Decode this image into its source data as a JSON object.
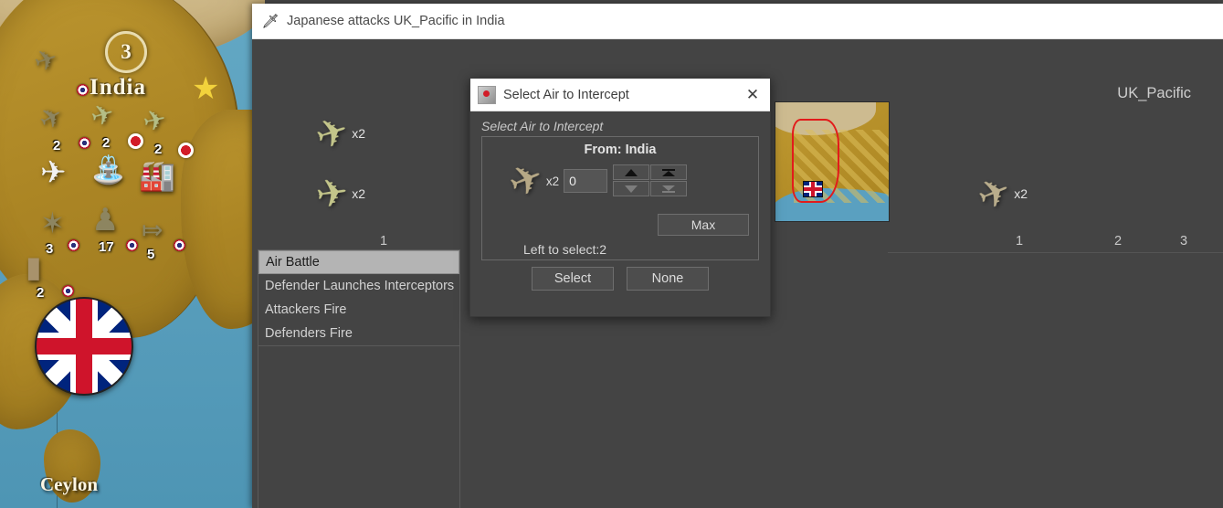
{
  "window": {
    "title": "Japanese attacks UK_Pacific in India",
    "icon": "battle-icon"
  },
  "map": {
    "territory_label": "India",
    "territory_value": "3",
    "island_label": "Ceylon",
    "owner_flag": "uk-flag",
    "units": [
      {
        "icon": "bomber-icon",
        "count": "",
        "glyph": "✈"
      },
      {
        "icon": "fighter-icon",
        "count": "2",
        "glyph": "✈"
      },
      {
        "icon": "fighter-green-icon",
        "count": "2",
        "glyph": "✈"
      },
      {
        "icon": "bomber-green-icon",
        "count": "2",
        "glyph": "✈"
      },
      {
        "icon": "aa-gun-icon",
        "count": "3",
        "glyph": "✦"
      },
      {
        "icon": "infantry-icon",
        "count": "17",
        "glyph": "♟"
      },
      {
        "icon": "artillery-icon",
        "count": "5",
        "glyph": "✇"
      },
      {
        "icon": "tank-icon",
        "count": "2",
        "glyph": "▰"
      }
    ]
  },
  "battle": {
    "attacker_name": "Japanese",
    "defender_name": "UK_Pacific",
    "steps": [
      {
        "label": "Air Battle",
        "selected": true
      },
      {
        "label": "Defender Launches Interceptors",
        "selected": false
      },
      {
        "label": "Attackers Fire",
        "selected": false
      },
      {
        "label": "Defenders Fire",
        "selected": false
      }
    ],
    "attacker_units": [
      {
        "icon": "fighter-icon",
        "quantity": "x2"
      },
      {
        "icon": "bomber-icon",
        "quantity": "x2"
      }
    ],
    "attacker_columns": [
      "1"
    ],
    "defender_units": [
      {
        "icon": "fighter-icon",
        "quantity": "x2"
      }
    ],
    "defender_columns": [
      "1",
      "2",
      "3"
    ]
  },
  "dialog": {
    "title": "Select Air to Intercept",
    "icon": "air-intercept-icon",
    "close_label": "✕",
    "caption": "Select Air to Intercept",
    "group_title": "From: India",
    "unit_icon": "fighter-icon",
    "unit_multiplier": "x2",
    "quantity_value": "0",
    "max_label": "Max",
    "left_to_select": "Left to select:2",
    "select_label": "Select",
    "none_label": "None",
    "spinner": {
      "up": "increment",
      "down": "decrement",
      "max_up": "increment-max",
      "max_down": "decrement-max"
    }
  },
  "colors": {
    "panel_bg": "#444444",
    "titlebar_bg": "#ffffff",
    "selected_item_bg": "#b4b4b4",
    "text_light": "#d2d2d2",
    "land": "#b8912c",
    "ocean": "#5aa0c0",
    "highlight_border": "#e21b1b"
  }
}
